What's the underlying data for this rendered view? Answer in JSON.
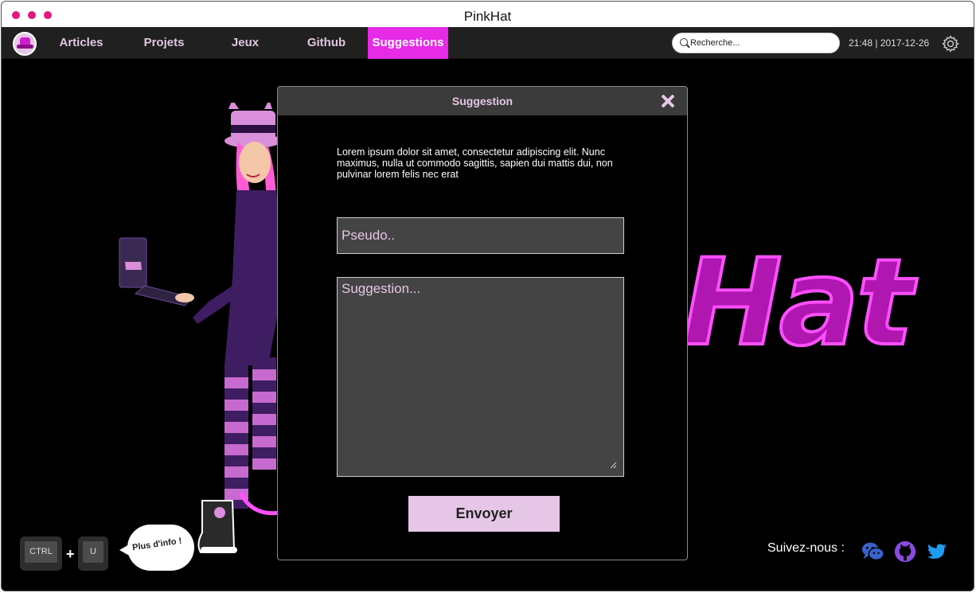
{
  "window": {
    "title": "PinkHat",
    "dot_color": "#e0197f"
  },
  "nav": {
    "logo_icon": "pinkhat-logo-icon",
    "items": [
      {
        "label": "Articles",
        "active": false
      },
      {
        "label": "Projets",
        "active": false
      },
      {
        "label": "Jeux",
        "active": false
      },
      {
        "label": "Github",
        "active": false
      },
      {
        "label": "Suggestions",
        "active": true
      }
    ],
    "accent_color": "#e62ae6",
    "search": {
      "placeholder": "Recherche...",
      "icon": "search-icon"
    },
    "clock": "21:48 | 2017-12-26",
    "settings_icon": "gear-icon"
  },
  "background": {
    "logo_text": "Hat"
  },
  "modal": {
    "title": "Suggestion",
    "close_icon": "close-icon",
    "description": "Lorem ipsum dolor sit amet, consectetur adipiscing elit. Nunc maximus, nulla ut commodo sagittis, sapien dui mattis dui, non pulvinar lorem felis nec erat",
    "pseudo_placeholder": "Pseudo..",
    "suggestion_placeholder": "Suggestion...",
    "submit_label": "Envoyer"
  },
  "shortcut": {
    "key1": "CTRL",
    "plus": "+",
    "key2": "U",
    "bubble_text": "Plus d'info !"
  },
  "social": {
    "label": "Suivez-nous :",
    "icons": [
      "wechat-icon",
      "github-icon",
      "twitter-icon"
    ]
  }
}
